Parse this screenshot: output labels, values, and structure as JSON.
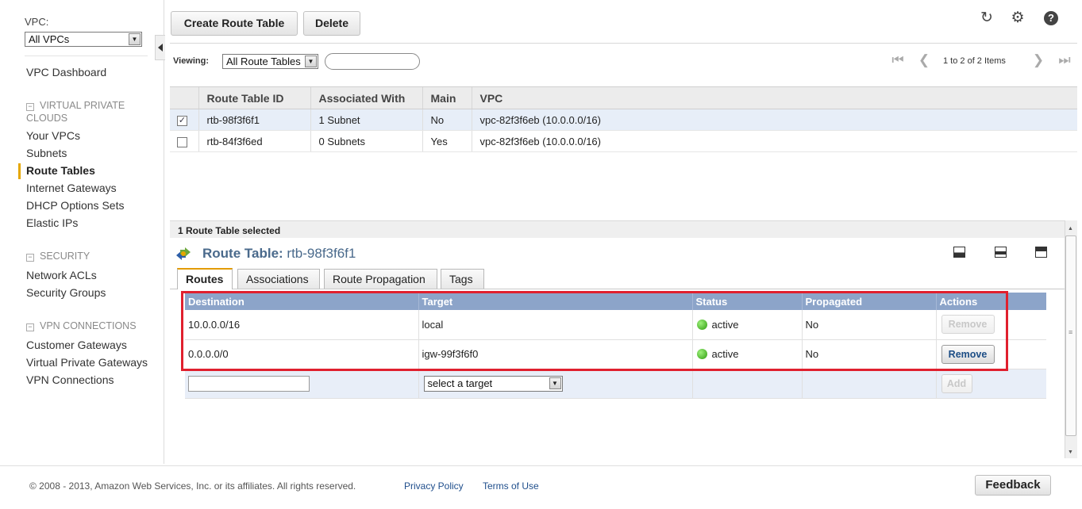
{
  "sidebar": {
    "vpc_label": "VPC:",
    "vpc_filter_value": "All VPCs",
    "dashboard": "VPC Dashboard",
    "sections": [
      {
        "title": "VIRTUAL PRIVATE CLOUDS",
        "items": [
          "Your VPCs",
          "Subnets",
          "Route Tables",
          "Internet Gateways",
          "DHCP Options Sets",
          "Elastic IPs"
        ]
      },
      {
        "title": "SECURITY",
        "items": [
          "Network ACLs",
          "Security Groups"
        ]
      },
      {
        "title": "VPN CONNECTIONS",
        "items": [
          "Customer Gateways",
          "Virtual Private Gateways",
          "VPN Connections"
        ]
      }
    ],
    "active_item": "Route Tables"
  },
  "toolbar": {
    "create_label": "Create Route Table",
    "delete_label": "Delete"
  },
  "filter": {
    "viewing_label": "Viewing:",
    "viewing_value": "All Route Tables",
    "search_value": "",
    "pager_text": "1 to 2 of 2 Items"
  },
  "grid": {
    "columns": [
      "Route Table ID",
      "Associated With",
      "Main",
      "VPC"
    ],
    "rows": [
      {
        "checked": true,
        "id": "rtb-98f3f6f1",
        "associated": "1 Subnet",
        "main": "No",
        "vpc": "vpc-82f3f6eb (10.0.0.0/16)"
      },
      {
        "checked": false,
        "id": "rtb-84f3f6ed",
        "associated": "0 Subnets",
        "main": "Yes",
        "vpc": "vpc-82f3f6eb (10.0.0.0/16)"
      }
    ]
  },
  "detail": {
    "selected_text": "1 Route Table selected",
    "title_label": "Route Table:",
    "title_value": "rtb-98f3f6f1",
    "tabs": [
      "Routes",
      "Associations",
      "Route Propagation",
      "Tags"
    ],
    "active_tab": "Routes",
    "routes_columns": [
      "Destination",
      "Target",
      "Status",
      "Propagated",
      "Actions"
    ],
    "routes": [
      {
        "destination": "10.0.0.0/16",
        "target": "local",
        "status": "active",
        "propagated": "No",
        "action": "Remove",
        "action_enabled": false
      },
      {
        "destination": "0.0.0.0/0",
        "target": "igw-99f3f6f0",
        "status": "active",
        "propagated": "No",
        "action": "Remove",
        "action_enabled": true
      }
    ],
    "add_row": {
      "destination_value": "",
      "target_placeholder": "select a target",
      "add_label": "Add"
    }
  },
  "footer": {
    "copyright": "© 2008 - 2013, Amazon Web Services, Inc. or its affiliates. All rights reserved.",
    "privacy": "Privacy Policy",
    "terms": "Terms of Use",
    "feedback": "Feedback"
  },
  "colors": {
    "accent": "#e5a700",
    "header_blue": "#8ca4c9",
    "highlight_red": "#e0202e",
    "link_blue": "#1f4e8c",
    "status_green": "#2f9b10"
  },
  "icons": [
    "refresh-icon",
    "gear-icon",
    "help-icon",
    "route-table-icon",
    "collapse-left-icon"
  ]
}
